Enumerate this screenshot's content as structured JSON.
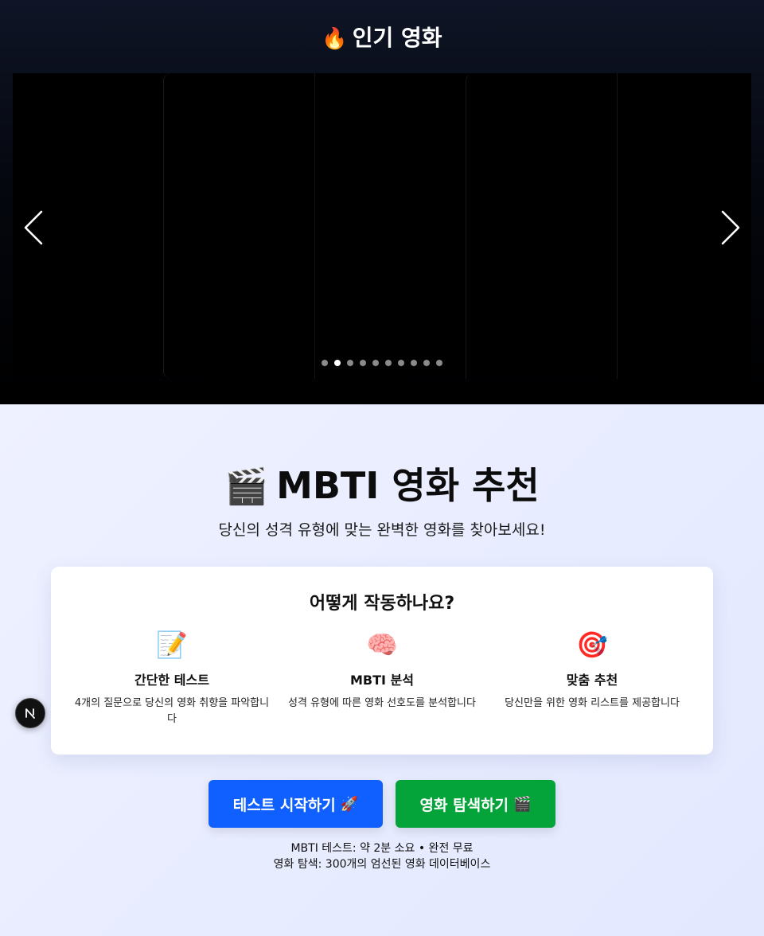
{
  "hero": {
    "title_icon": "🔥",
    "title": "인기 영화",
    "prev_icon": "chevron-left-icon",
    "next_icon": "chevron-right-icon",
    "dot_count": 10,
    "active_dot": 2
  },
  "main": {
    "title_icon": "🎬",
    "title": "MBTI 영화 추천",
    "subtitle": "당신의 성격 유형에 맞는 완벽한 영화를 찾아보세요!"
  },
  "how_it_works": {
    "title": "어떻게 작동하나요?",
    "features": [
      {
        "icon": "📝",
        "title": "간단한 테스트",
        "desc": "4개의 질문으로 당신의 영화 취향을 파악합니다"
      },
      {
        "icon": "🧠",
        "title": "MBTI 분석",
        "desc": "성격 유형에 따른 영화 선호도를 분석합니다"
      },
      {
        "icon": "🎯",
        "title": "맞춤 추천",
        "desc": "당신만을 위한 영화 리스트를 제공합니다"
      }
    ]
  },
  "buttons": {
    "test_label": "테스트 시작하기",
    "test_emoji": "🚀",
    "explore_label": "영화 탐색하기",
    "explore_emoji": "🎬"
  },
  "info": {
    "line1": "MBTI 테스트: 약 2분 소요 • 완전 무료",
    "line2": "영화 탐색: 300개의 엄선된 영화 데이터베이스"
  },
  "colors": {
    "primary_button": "#1060ff",
    "secondary_button": "#05a43a",
    "hero_bg": "#000000",
    "page_bg": "#e6ebff"
  }
}
